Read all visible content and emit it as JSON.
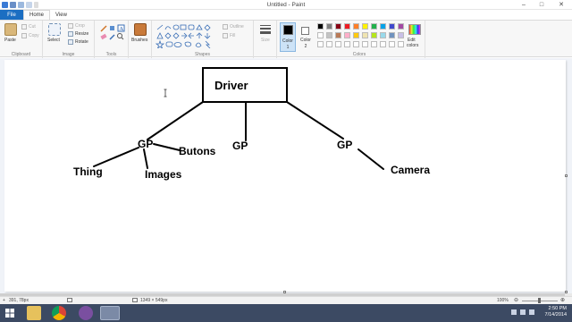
{
  "window": {
    "title": "Untitled - Paint",
    "minimize_glyph": "–",
    "maximize_glyph": "□",
    "close_glyph": "✕"
  },
  "tabs": [
    "File",
    "Home",
    "View"
  ],
  "ribbon": {
    "clipboard": {
      "label": "Clipboard",
      "paste": "Paste",
      "cut": "Cut",
      "copy": "Copy"
    },
    "image": {
      "label": "Image",
      "select": "Select",
      "crop": "Crop",
      "resize": "Resize",
      "rotate": "Rotate"
    },
    "tools": {
      "label": "Tools"
    },
    "brushes": {
      "label": "Brushes"
    },
    "shapes": {
      "label": "Shapes",
      "outline": "Outline",
      "fill": "Fill"
    },
    "size": {
      "label": "Size"
    },
    "color1": {
      "label": "Color",
      "sub": "1"
    },
    "color2": {
      "label": "Color",
      "sub": "2"
    },
    "colors": {
      "label": "Colors",
      "edit": "Edit",
      "edit2": "colors",
      "row1": [
        "#000000",
        "#7f7f7f",
        "#880015",
        "#ed1c24",
        "#ff7f27",
        "#fff200",
        "#22b14c",
        "#00a2e8",
        "#3f48cc",
        "#a349a4"
      ],
      "row2": [
        "#ffffff",
        "#c3c3c3",
        "#b97a57",
        "#ffaec9",
        "#ffc90e",
        "#efe4b0",
        "#b5e61d",
        "#99d9ea",
        "#7092be",
        "#c8bfe7"
      ]
    }
  },
  "diagram": {
    "driver": "Driver",
    "gp_left": "GP",
    "gp_mid": "GP",
    "gp_right": "GP",
    "thing": "Thing",
    "images": "Images",
    "butons": "Butons",
    "camera": "Camera"
  },
  "status": {
    "cursor": "391, 78px",
    "canvas_size": "1349 × 549px",
    "zoom": "100%"
  },
  "taskbar": {
    "time": "2:50 PM",
    "date": "7/14/2014"
  }
}
